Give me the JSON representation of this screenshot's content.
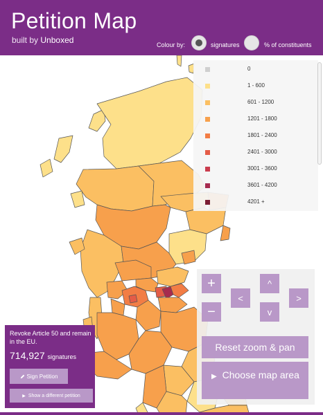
{
  "header": {
    "title": "Petition Map",
    "subtitle_prefix": "built by",
    "subtitle_brand": "Unboxed",
    "colour_by_label": "Colour by:",
    "options": [
      {
        "label": "signatures",
        "selected": true
      },
      {
        "label": "% of constituents",
        "selected": false
      }
    ]
  },
  "legend": {
    "items": [
      {
        "label": "0",
        "color": "#d0d0d0"
      },
      {
        "label": "1 - 600",
        "color": "#fde08a"
      },
      {
        "label": "601 - 1200",
        "color": "#fbbf62"
      },
      {
        "label": "1201 - 1800",
        "color": "#f7a04c"
      },
      {
        "label": "1801 - 2400",
        "color": "#f27d45"
      },
      {
        "label": "2401 - 3000",
        "color": "#e45c47"
      },
      {
        "label": "3001 - 3600",
        "color": "#ca3c4d"
      },
      {
        "label": "3601 - 4200",
        "color": "#a62b4e"
      },
      {
        "label": "4201 +",
        "color": "#7b1d33"
      }
    ]
  },
  "map": {
    "region": "Scotland and northern England",
    "sea_color": "#ffffff",
    "border_color": "#555555"
  },
  "controls": {
    "zoom_in": "+",
    "zoom_out": "−",
    "pan_up": "^",
    "pan_down": "v",
    "pan_left": "<",
    "pan_right": ">",
    "reset_label": "Reset zoom & pan",
    "choose_area_label": "Choose map area",
    "choose_area_icon": "▶"
  },
  "petition": {
    "title": "Revoke Article 50 and remain in the EU.",
    "count": "714,927",
    "count_label": "signatures",
    "sign_label": "Sign Petition",
    "sign_icon": "pencil-icon",
    "other_label": "Show a different petition",
    "other_icon": "▶"
  },
  "colors": {
    "brand": "#7b2d87",
    "button": "#b998c8"
  }
}
